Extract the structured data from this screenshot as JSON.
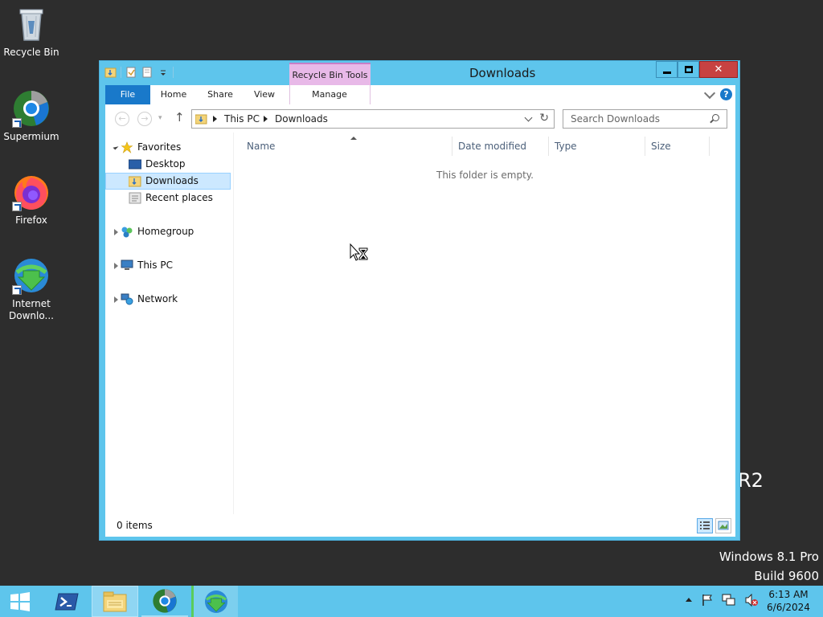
{
  "desktop": {
    "icons": [
      {
        "label": "Recycle Bin"
      },
      {
        "label": "Supermium"
      },
      {
        "label": "Firefox"
      },
      {
        "label": "Internet\nDownlo..."
      }
    ],
    "watermark_os": "Windows 8.1 Pro",
    "watermark_build": "Build 9600",
    "watermark_edge": "R2"
  },
  "window": {
    "title": "Downloads",
    "context_tab_group": "Recycle Bin Tools",
    "ribbon_tabs": {
      "file": "File",
      "home": "Home",
      "share": "Share",
      "view": "View",
      "manage": "Manage"
    },
    "help_label": "?",
    "close_label": "✕",
    "address": {
      "crumbs": [
        "This PC",
        "Downloads"
      ]
    },
    "search": {
      "placeholder": "Search Downloads"
    },
    "nav_tree": {
      "favorites": "Favorites",
      "desktop": "Desktop",
      "downloads": "Downloads",
      "recent": "Recent places",
      "homegroup": "Homegroup",
      "this_pc": "This PC",
      "network": "Network"
    },
    "columns": {
      "name": "Name",
      "date_modified": "Date modified",
      "type": "Type",
      "size": "Size"
    },
    "empty_message": "This folder is empty.",
    "status": "0 items"
  },
  "taskbar": {
    "clock_time": "6:13 AM",
    "clock_date": "6/6/2024"
  },
  "colors": {
    "accent": "#5ec5ec",
    "file_tab": "#1979ca",
    "context_tab": "#e8b9e8",
    "close_button": "#c74242",
    "selected_item": "#cce8ff"
  }
}
